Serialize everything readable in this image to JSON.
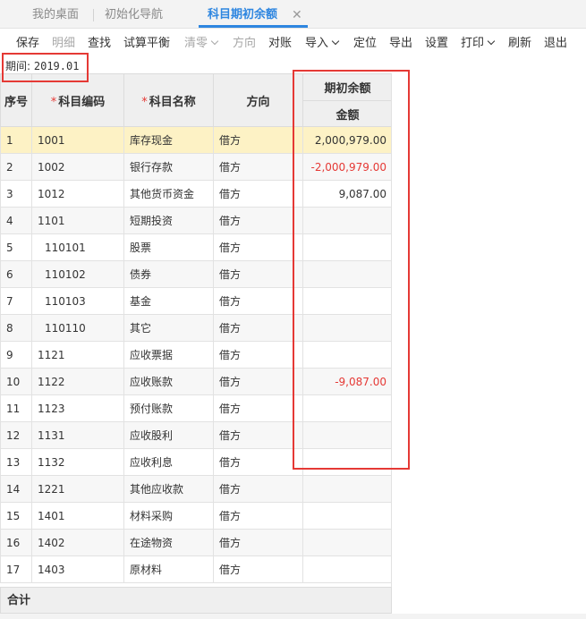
{
  "tabs": [
    {
      "label": "我的桌面"
    },
    {
      "label": "初始化导航"
    },
    {
      "label": "科目期初余额"
    }
  ],
  "tab_close_glyph": "✕",
  "toolbar": {
    "save": "保存",
    "detail": "明细",
    "find": "查找",
    "trial_balance": "试算平衡",
    "clear_zero": "清零",
    "direction": "方向",
    "reconcile": "对账",
    "import": "导入",
    "locate": "定位",
    "export": "导出",
    "settings": "设置",
    "print": "打印",
    "refresh": "刷新",
    "exit": "退出"
  },
  "period": {
    "label": "期间:",
    "value": "2019.01"
  },
  "table": {
    "headers": {
      "seq": "序号",
      "code": "科目编码",
      "name": "科目名称",
      "direction": "方向",
      "opening_balance": "期初余额",
      "amount": "金额"
    },
    "required_mark": "*",
    "rows": [
      {
        "seq": "1",
        "code": "1001",
        "name": "库存现金",
        "direction": "借方",
        "amount": "2,000,979.00"
      },
      {
        "seq": "2",
        "code": "1002",
        "name": "银行存款",
        "direction": "借方",
        "amount": "-2,000,979.00"
      },
      {
        "seq": "3",
        "code": "1012",
        "name": "其他货币资金",
        "direction": "借方",
        "amount": "9,087.00"
      },
      {
        "seq": "4",
        "code": "1101",
        "name": "短期投资",
        "direction": "借方",
        "amount": ""
      },
      {
        "seq": "5",
        "code": "110101",
        "name": "股票",
        "direction": "借方",
        "amount": ""
      },
      {
        "seq": "6",
        "code": "110102",
        "name": "债券",
        "direction": "借方",
        "amount": ""
      },
      {
        "seq": "7",
        "code": "110103",
        "name": "基金",
        "direction": "借方",
        "amount": ""
      },
      {
        "seq": "8",
        "code": "110110",
        "name": "其它",
        "direction": "借方",
        "amount": ""
      },
      {
        "seq": "9",
        "code": "1121",
        "name": "应收票据",
        "direction": "借方",
        "amount": ""
      },
      {
        "seq": "10",
        "code": "1122",
        "name": "应收账款",
        "direction": "借方",
        "amount": "-9,087.00"
      },
      {
        "seq": "11",
        "code": "1123",
        "name": "预付账款",
        "direction": "借方",
        "amount": ""
      },
      {
        "seq": "12",
        "code": "1131",
        "name": "应收股利",
        "direction": "借方",
        "amount": ""
      },
      {
        "seq": "13",
        "code": "1132",
        "name": "应收利息",
        "direction": "借方",
        "amount": ""
      },
      {
        "seq": "14",
        "code": "1221",
        "name": "其他应收款",
        "direction": "借方",
        "amount": ""
      },
      {
        "seq": "15",
        "code": "1401",
        "name": "材料采购",
        "direction": "借方",
        "amount": ""
      },
      {
        "seq": "16",
        "code": "1402",
        "name": "在途物资",
        "direction": "借方",
        "amount": ""
      },
      {
        "seq": "17",
        "code": "1403",
        "name": "原材料",
        "direction": "借方",
        "amount": ""
      }
    ]
  },
  "footer": {
    "total_label": "合计"
  },
  "colors": {
    "accent": "#2e86e0",
    "negative": "#e53935",
    "highlight_box": "#e53935",
    "selected_row": "#fdf2c5"
  }
}
